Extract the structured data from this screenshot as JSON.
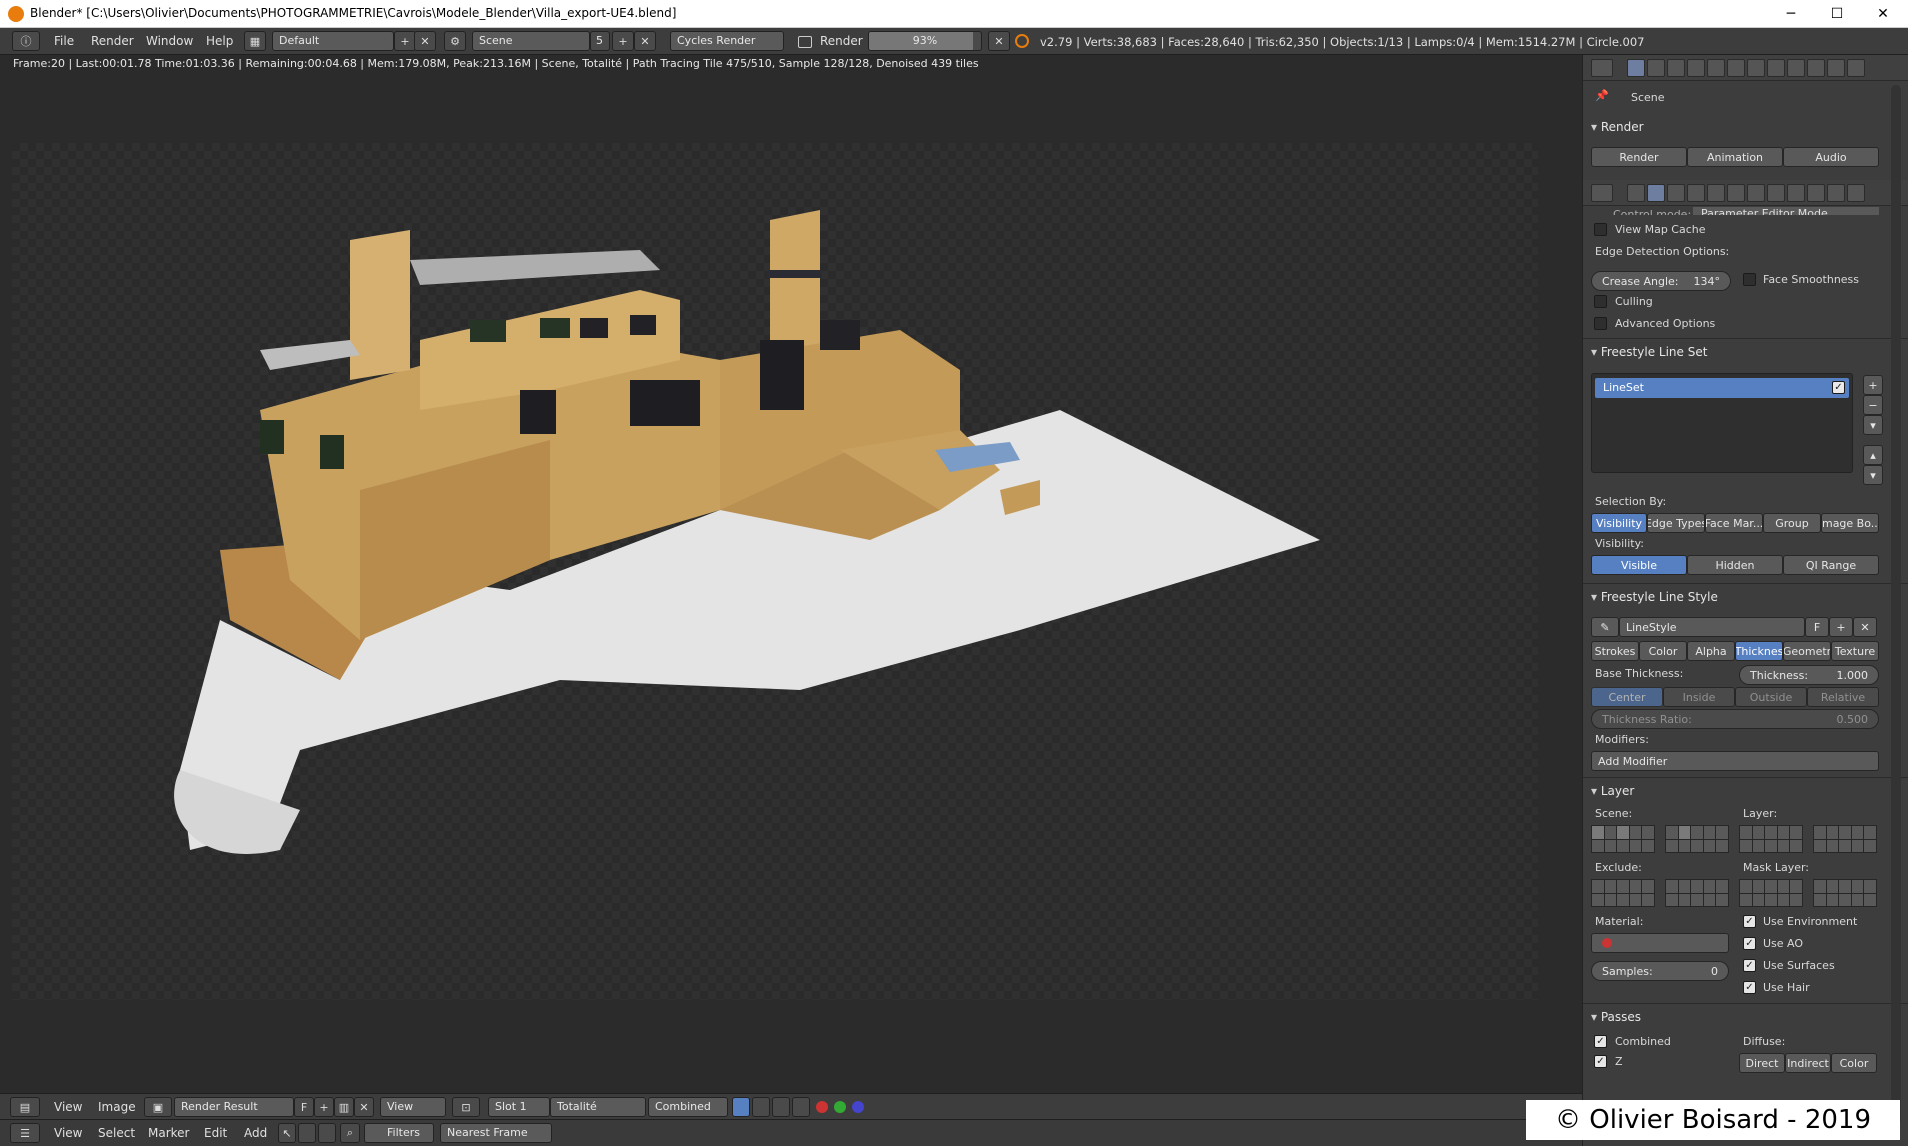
{
  "window": {
    "title": "Blender* [C:\\Users\\Olivier\\Documents\\PHOTOGRAMMETRIE\\Cavrois\\Modele_Blender\\Villa_export-UE4.blend]",
    "minimize": "─",
    "maximize": "☐",
    "close": "✕"
  },
  "info_header": {
    "menus": [
      "File",
      "Render",
      "Window",
      "Help"
    ],
    "layout": "Default",
    "scene": "Scene",
    "scene_users": "5",
    "engine": "Cycles Render",
    "render_label": "Render",
    "progress": "93%",
    "progress_value": 0.93,
    "stats": "v2.79 | Verts:38,683 | Faces:28,640 | Tris:62,350 | Objects:1/13 | Lamps:0/4 | Mem:1514.27M | Circle.007"
  },
  "viewport": {
    "status": "Frame:20 | Last:00:01.78 Time:01:03.36 | Remaining:00:04.68 | Mem:179.08M, Peak:213.16M | Scene, Totalité | Path Tracing Tile 475/510, Sample 128/128, Denoised 439 tiles"
  },
  "properties": {
    "breadcrumb": "Scene",
    "render_panel": {
      "title": "Render",
      "render_btn": "Render",
      "animation_btn": "Animation",
      "audio_btn": "Audio"
    },
    "control_mode_label": "Control mode:",
    "control_mode_value": "Parameter Editor Mode",
    "view_map_cache": "View Map Cache",
    "edge_detection": "Edge Detection Options:",
    "crease_angle_label": "Crease Angle:",
    "crease_angle_value": "134°",
    "face_smoothness": "Face Smoothness",
    "culling": "Culling",
    "advanced_options": "Advanced Options",
    "lineset_panel": {
      "title": "Freestyle Line Set",
      "item": "LineSet",
      "selection_by": "Selection By:",
      "selection_tabs": [
        "Visibility",
        "Edge Types",
        "Face Mar...",
        "Group",
        "Image Bo..."
      ],
      "visibility_label": "Visibility:",
      "visibility_tabs": [
        "Visible",
        "Hidden",
        "QI Range"
      ]
    },
    "linestyle_panel": {
      "title": "Freestyle Line Style",
      "name": "LineStyle",
      "fake_user": "F",
      "tabs": [
        "Strokes",
        "Color",
        "Alpha",
        "Thicknes",
        "Geometr",
        "Texture"
      ],
      "base_thickness": "Base Thickness:",
      "thickness_label": "Thickness:",
      "thickness_value": "1.000",
      "position_tabs": [
        "Center",
        "Inside",
        "Outside",
        "Relative"
      ],
      "thickness_ratio_label": "Thickness Ratio:",
      "thickness_ratio_value": "0.500",
      "modifiers": "Modifiers:",
      "add_modifier": "Add Modifier"
    },
    "layer_panel": {
      "title": "Layer",
      "scene": "Scene:",
      "layer": "Layer:",
      "exclude": "Exclude:",
      "mask_layer": "Mask Layer:",
      "material": "Material:",
      "use_environment": "Use Environment",
      "use_ao": "Use AO",
      "use_surfaces": "Use Surfaces",
      "use_hair": "Use Hair",
      "samples_label": "Samples:",
      "samples_value": "0"
    },
    "passes_panel": {
      "title": "Passes",
      "combined": "Combined",
      "z": "Z",
      "diffuse": "Diffuse:",
      "direct": "Direct",
      "indirect": "Indirect",
      "color": "Color"
    }
  },
  "image_editor_header": {
    "view": "View",
    "image": "Image",
    "image_name": "Render Result",
    "fake_user": "F",
    "view_mode": "View",
    "slot": "Slot 1",
    "layer": "Totalité",
    "pass": "Combined"
  },
  "timeline_header": {
    "menus": [
      "View",
      "Select",
      "Marker",
      "Edit",
      "Add"
    ],
    "filters": "Filters",
    "interp": "Nearest Frame"
  },
  "watermark": "© Olivier Boisard - 2019",
  "colors": {
    "accent": "#5680c2",
    "brick": "#c9a15e",
    "ground": "#e4e4e4"
  }
}
